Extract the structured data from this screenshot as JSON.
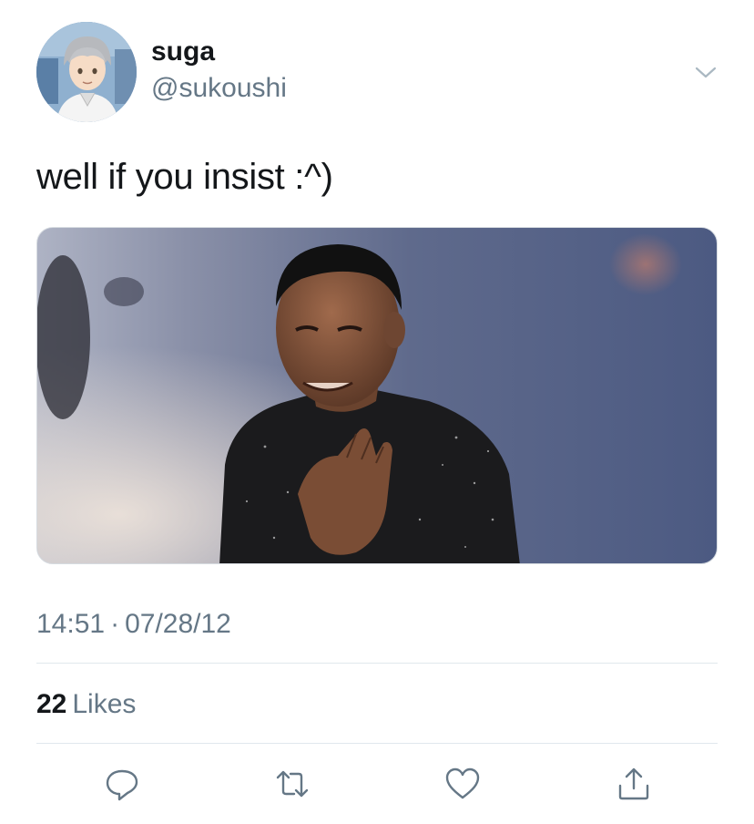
{
  "user": {
    "display_name": "suga",
    "handle": "@sukoushi",
    "avatar_icon": "avatar-anime-character"
  },
  "tweet": {
    "text": "well if you insist :^)",
    "media_description_icon": "gif-man-clapping-image"
  },
  "meta": {
    "time": "14:51",
    "separator": "·",
    "date": "07/28/12"
  },
  "stats": {
    "likes_count": "22",
    "likes_label": "Likes"
  },
  "actions": {
    "reply_icon": "reply-icon",
    "retweet_icon": "retweet-icon",
    "like_icon": "heart-icon",
    "share_icon": "share-icon",
    "more_icon": "chevron-down-icon"
  },
  "colors": {
    "text_primary": "#14171a",
    "text_secondary": "#657786",
    "divider": "#e1e8ed"
  }
}
